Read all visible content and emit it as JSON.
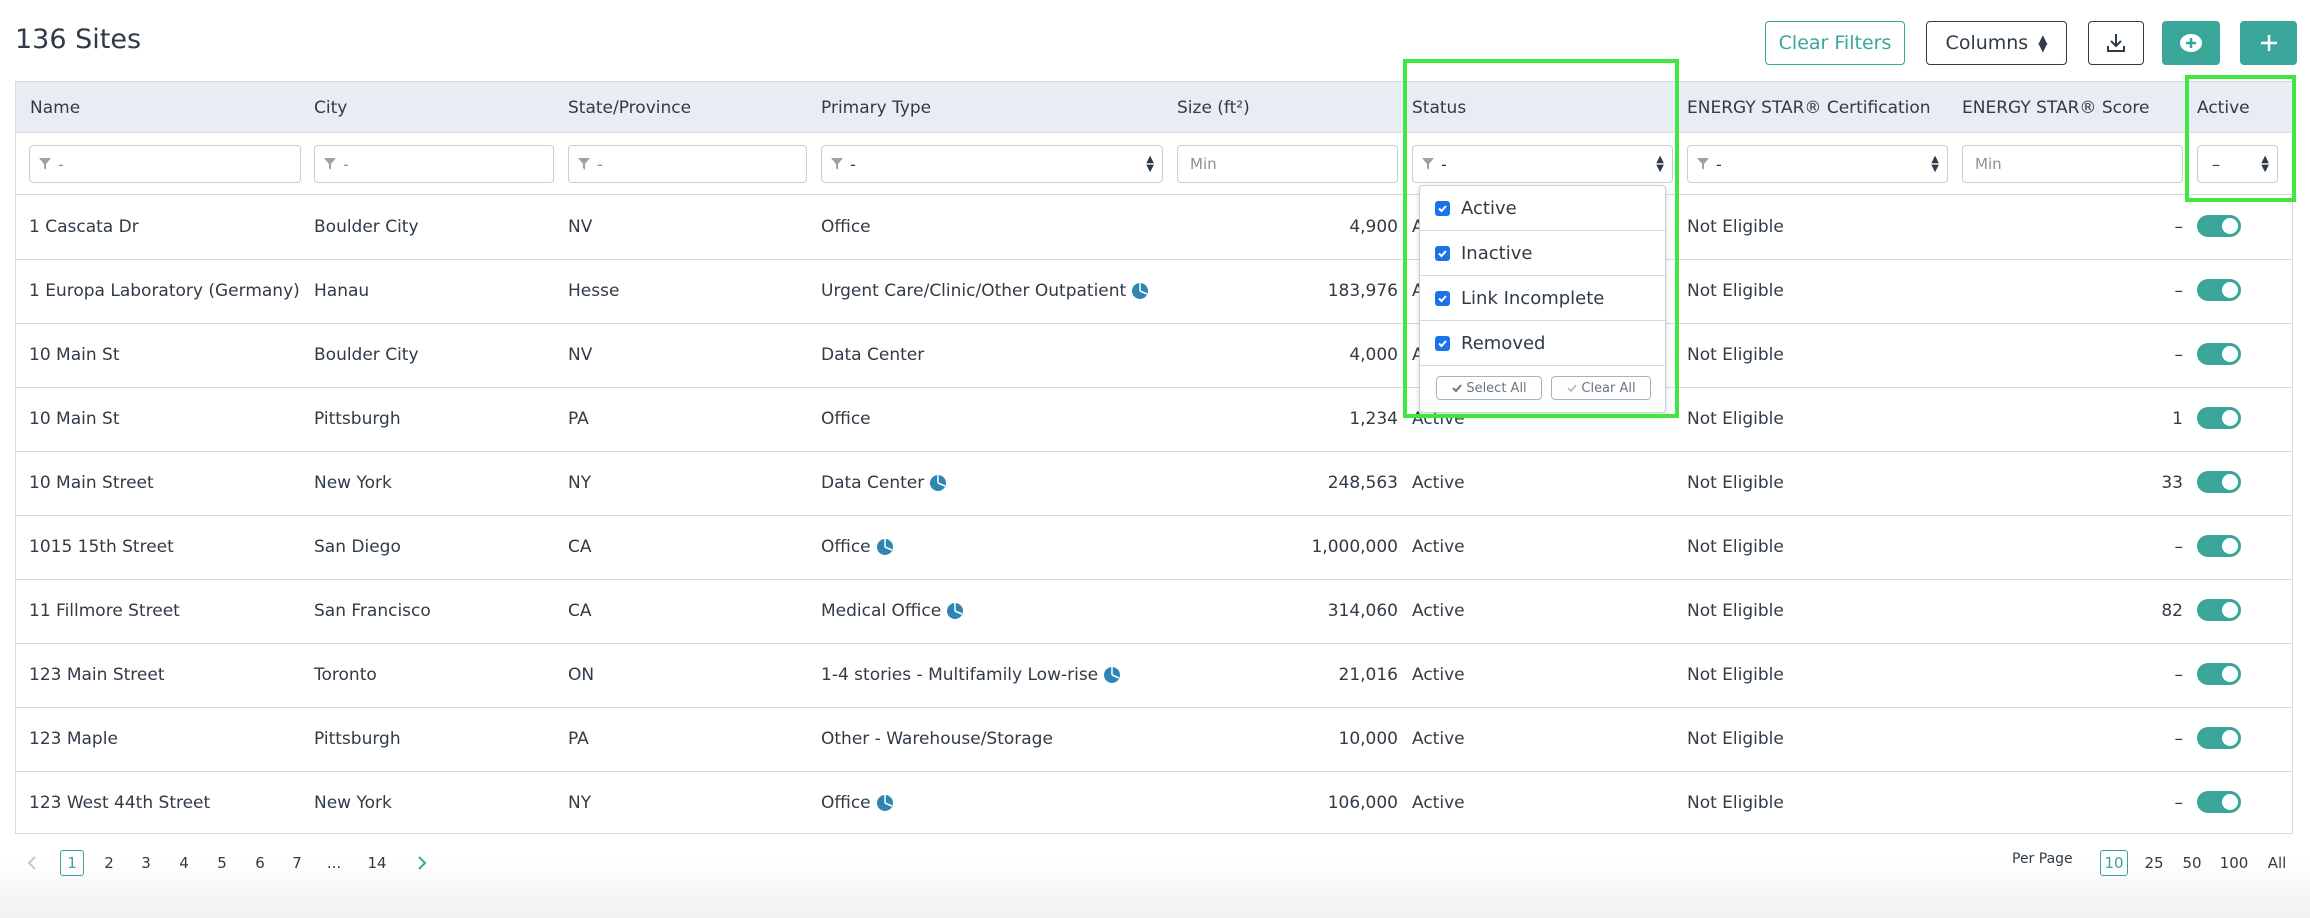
{
  "header": {
    "title": "136 Sites",
    "clear_filters": "Clear Filters",
    "columns": "Columns"
  },
  "columns": [
    "Name",
    "City",
    "State/Province",
    "Primary Type",
    "Size (ft²)",
    "Status",
    "ENERGY STAR® Certification",
    "ENERGY STAR® Score",
    "Active"
  ],
  "filters": {
    "name": "-",
    "city": "-",
    "state": "-",
    "primary_type": "-",
    "size_placeholder": "Min",
    "status": "-",
    "certification": "-",
    "score_placeholder": "Min",
    "active": "–"
  },
  "rows": [
    {
      "name": "1 Cascata Dr",
      "city": "Boulder City",
      "state": "NV",
      "type": "Office",
      "type_icon": false,
      "size": "4,900",
      "status": "Active",
      "cert": "Not Eligible",
      "score": "–",
      "active": true
    },
    {
      "name": "1 Europa Laboratory (Germany)",
      "city": "Hanau",
      "state": "Hesse",
      "type": "Urgent Care/Clinic/Other Outpatient",
      "type_icon": true,
      "size": "183,976",
      "status": "Active",
      "cert": "Not Eligible",
      "score": "–",
      "active": true
    },
    {
      "name": "10 Main St",
      "city": "Boulder City",
      "state": "NV",
      "type": "Data Center",
      "type_icon": false,
      "size": "4,000",
      "status": "Active",
      "cert": "Not Eligible",
      "score": "–",
      "active": true
    },
    {
      "name": "10 Main St",
      "city": "Pittsburgh",
      "state": "PA",
      "type": "Office",
      "type_icon": false,
      "size": "1,234",
      "status": "Active",
      "cert": "Not Eligible",
      "score": "1",
      "active": true
    },
    {
      "name": "10 Main Street",
      "city": "New York",
      "state": "NY",
      "type": "Data Center",
      "type_icon": true,
      "size": "248,563",
      "status": "Active",
      "cert": "Not Eligible",
      "score": "33",
      "active": true
    },
    {
      "name": "1015 15th Street",
      "city": "San Diego",
      "state": "CA",
      "type": "Office",
      "type_icon": true,
      "size": "1,000,000",
      "status": "Active",
      "cert": "Not Eligible",
      "score": "–",
      "active": true
    },
    {
      "name": "11 Fillmore Street",
      "city": "San Francisco",
      "state": "CA",
      "type": "Medical Office",
      "type_icon": true,
      "size": "314,060",
      "status": "Active",
      "cert": "Not Eligible",
      "score": "82",
      "active": true
    },
    {
      "name": "123 Main Street",
      "city": "Toronto",
      "state": "ON",
      "type": "1-4 stories - Multifamily Low-rise",
      "type_icon": true,
      "size": "21,016",
      "status": "Active",
      "cert": "Not Eligible",
      "score": "–",
      "active": true
    },
    {
      "name": "123 Maple",
      "city": "Pittsburgh",
      "state": "PA",
      "type": "Other - Warehouse/Storage",
      "type_icon": false,
      "size": "10,000",
      "status": "Active",
      "cert": "Not Eligible",
      "score": "–",
      "active": true
    },
    {
      "name": "123 West 44th Street",
      "city": "New York",
      "state": "NY",
      "type": "Office",
      "type_icon": true,
      "size": "106,000",
      "status": "Active",
      "cert": "Not Eligible",
      "score": "–",
      "active": true
    }
  ],
  "status_dropdown": {
    "options": [
      {
        "label": "Active",
        "checked": true
      },
      {
        "label": "Inactive",
        "checked": true
      },
      {
        "label": "Link Incomplete",
        "checked": true
      },
      {
        "label": "Removed",
        "checked": true
      }
    ],
    "select_all": "Select All",
    "clear_all": "Clear All"
  },
  "pagination": {
    "pages": [
      "1",
      "2",
      "3",
      "4",
      "5",
      "6",
      "7",
      "...",
      "14"
    ],
    "current": "1",
    "per_page_label": "Per Page",
    "per_page_options": [
      "10",
      "25",
      "50",
      "100",
      "All"
    ],
    "per_page_current": "10"
  },
  "colors": {
    "accent": "#3aa69a",
    "highlight": "#3ee63e",
    "checkbox": "#1a73e8",
    "pie_icon": "#2f86b5"
  }
}
